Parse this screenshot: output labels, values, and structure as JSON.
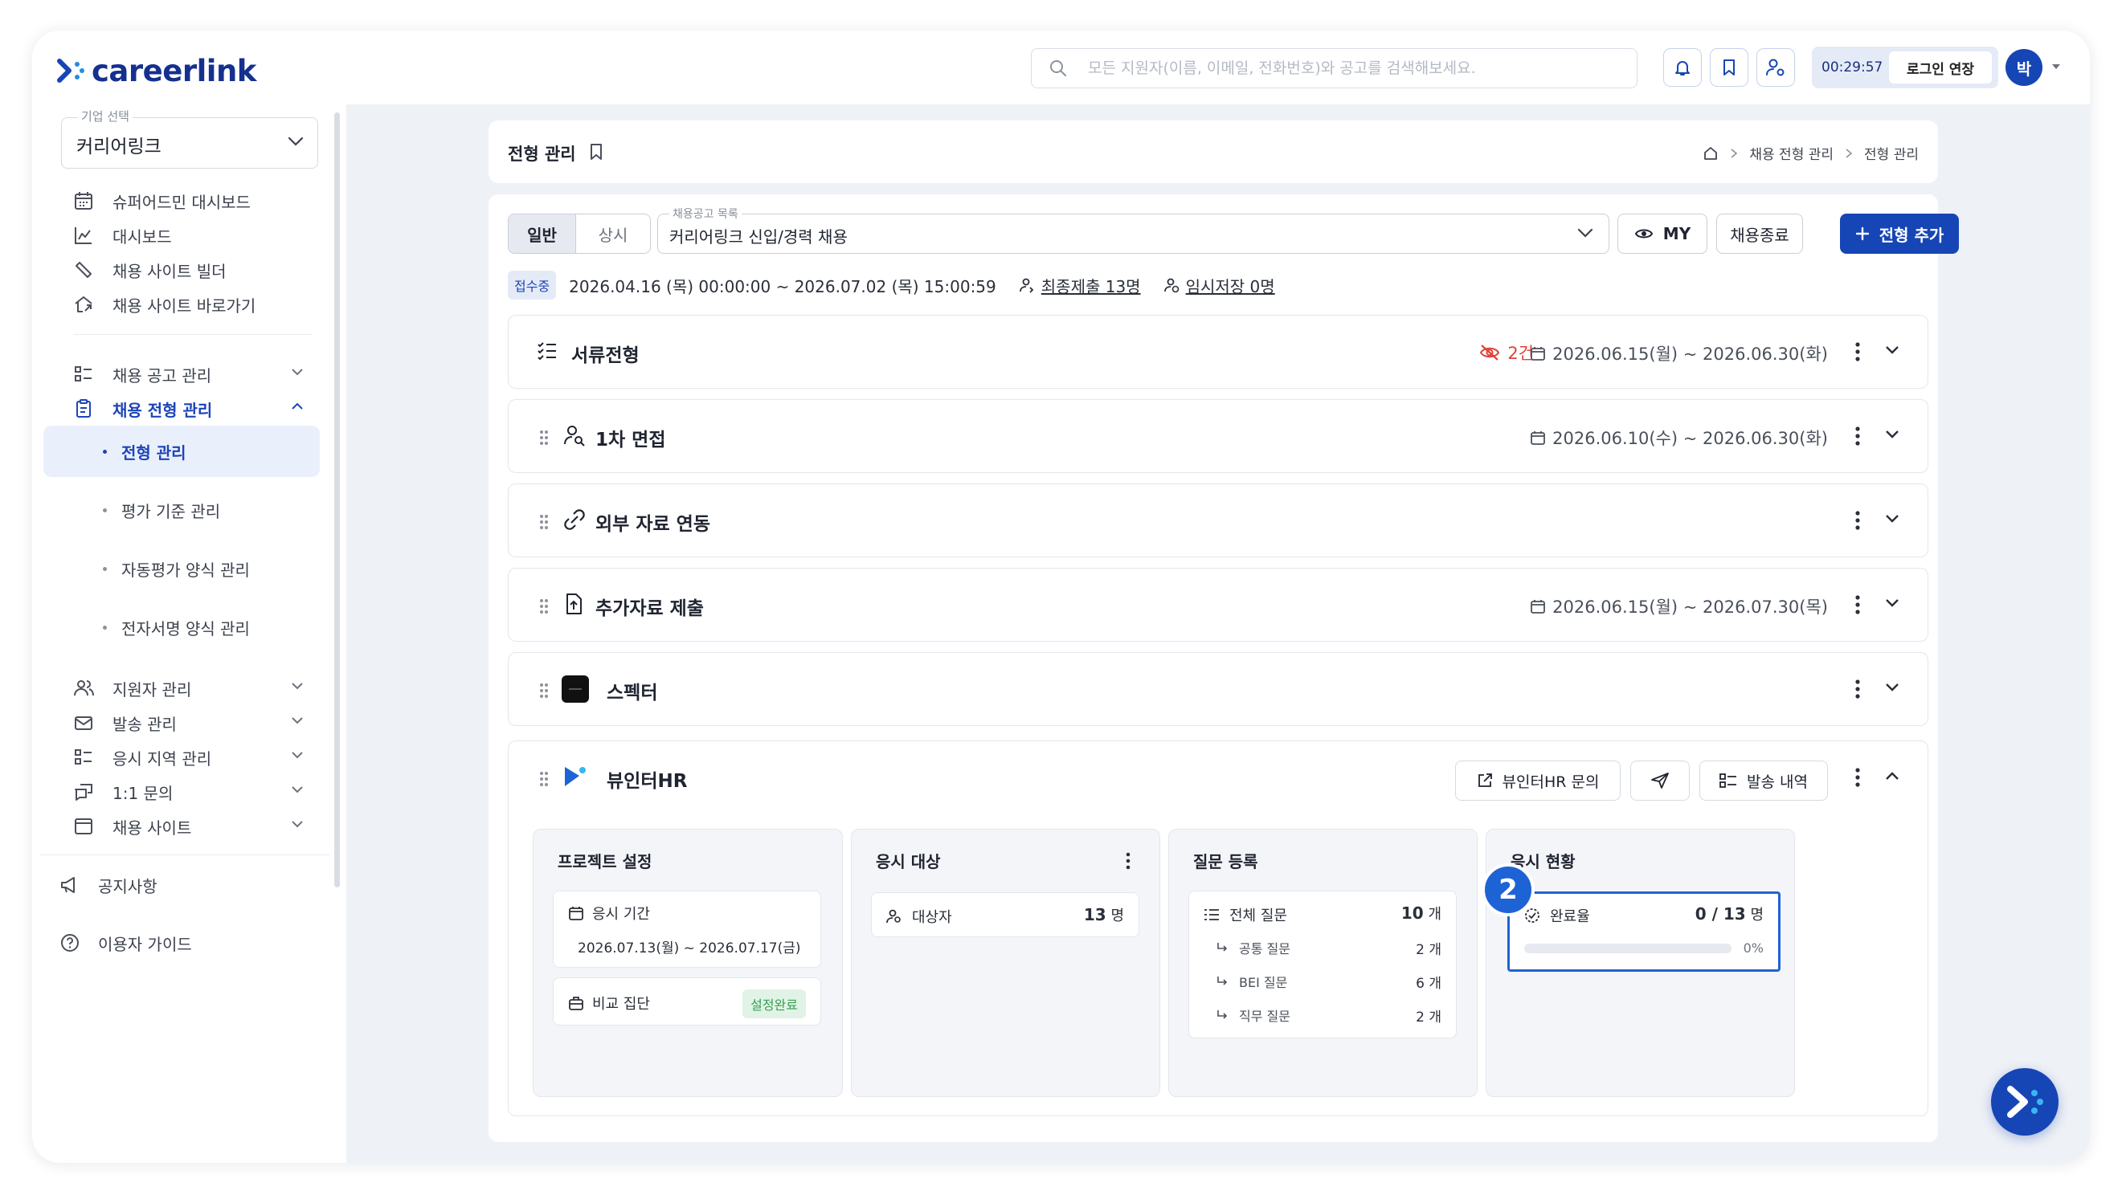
{
  "header": {
    "logo_text": "careerlink",
    "search_placeholder": "모든 지원자(이름, 이메일, 전화번호)와 공고를 검색해보세요.",
    "timer": "00:29:57",
    "extend_login_label": "로그인 연장",
    "avatar_initial": "박",
    "accent_color": "#1645b5"
  },
  "sidebar": {
    "company_caption": "기업 선택",
    "company_value": "커리어링크",
    "items": [
      {
        "label": "슈퍼어드민 대시보드"
      },
      {
        "label": "대시보드"
      },
      {
        "label": "채용 사이트 빌더"
      },
      {
        "label": "채용 사이트 바로가기"
      },
      {
        "label": "채용 공고 관리"
      },
      {
        "label": "채용 전형 관리"
      }
    ],
    "subitems": [
      {
        "label": "전형 관리"
      },
      {
        "label": "평가 기준 관리"
      },
      {
        "label": "자동평가 양식 관리"
      },
      {
        "label": "전자서명 양식 관리"
      }
    ],
    "items2": [
      {
        "label": "지원자 관리"
      },
      {
        "label": "발송 관리"
      },
      {
        "label": "응시 지역 관리"
      },
      {
        "label": "1:1 문의"
      },
      {
        "label": "채용 사이트"
      }
    ],
    "bottom": [
      {
        "label": "공지사항"
      },
      {
        "label": "이용자 가이드"
      }
    ]
  },
  "breadcrumb": {
    "page_title": "전형 관리",
    "path": [
      "채용 전형 관리",
      "전형 관리"
    ]
  },
  "toolbar": {
    "seg_general": "일반",
    "seg_always": "상시",
    "job_caption": "채용공고 목록",
    "job_value": "커리어링크 신입/경력 채용",
    "my_label": "MY",
    "end_label": "채용종료",
    "add_label": "전형 추가"
  },
  "info": {
    "status": "접수중",
    "period": "2026.04.16 (목) 00:00:00 ~ 2026.07.02 (목) 15:00:59",
    "final_submit": "최종제출 13명",
    "temp_save": "임시저장 0명"
  },
  "stages": [
    {
      "name": "서류전형",
      "hidden_count": "2건",
      "date": "2026.06.15(월) ~ 2026.06.30(화)"
    },
    {
      "name": "1차 면접",
      "date": "2026.06.10(수) ~ 2026.06.30(화)"
    },
    {
      "name": "외부 자료 연동"
    },
    {
      "name": "추가자료 제출",
      "date": "2026.06.15(월) ~ 2026.07.30(목)"
    },
    {
      "name": "스펙터"
    },
    {
      "name": "뷰인터HR"
    }
  ],
  "viewinter": {
    "inquiry_label": "뷰인터HR 문의",
    "history_label": "발송 내역",
    "project": {
      "title": "프로젝트 설정",
      "period_label": "응시 기간",
      "period_value": "2026.07.13(월) ~ 2026.07.17(금)",
      "group_label": "비교 집단",
      "group_status": "설정완료"
    },
    "target": {
      "title": "응시 대상",
      "label": "대상자",
      "count": "13",
      "unit": "명"
    },
    "questions": {
      "title": "질문 등록",
      "total_label": "전체 질문",
      "total_count": "10",
      "unit": "개",
      "items": [
        {
          "label": "공통 질문",
          "count": "2 개"
        },
        {
          "label": "BEI 질문",
          "count": "6 개"
        },
        {
          "label": "직무 질문",
          "count": "2 개"
        }
      ]
    },
    "status": {
      "title": "응시 현황",
      "label": "완료율",
      "value": "0 / 13",
      "unit": "명",
      "percent": "0%",
      "progress_fraction": 0
    }
  },
  "step_marker": "2"
}
